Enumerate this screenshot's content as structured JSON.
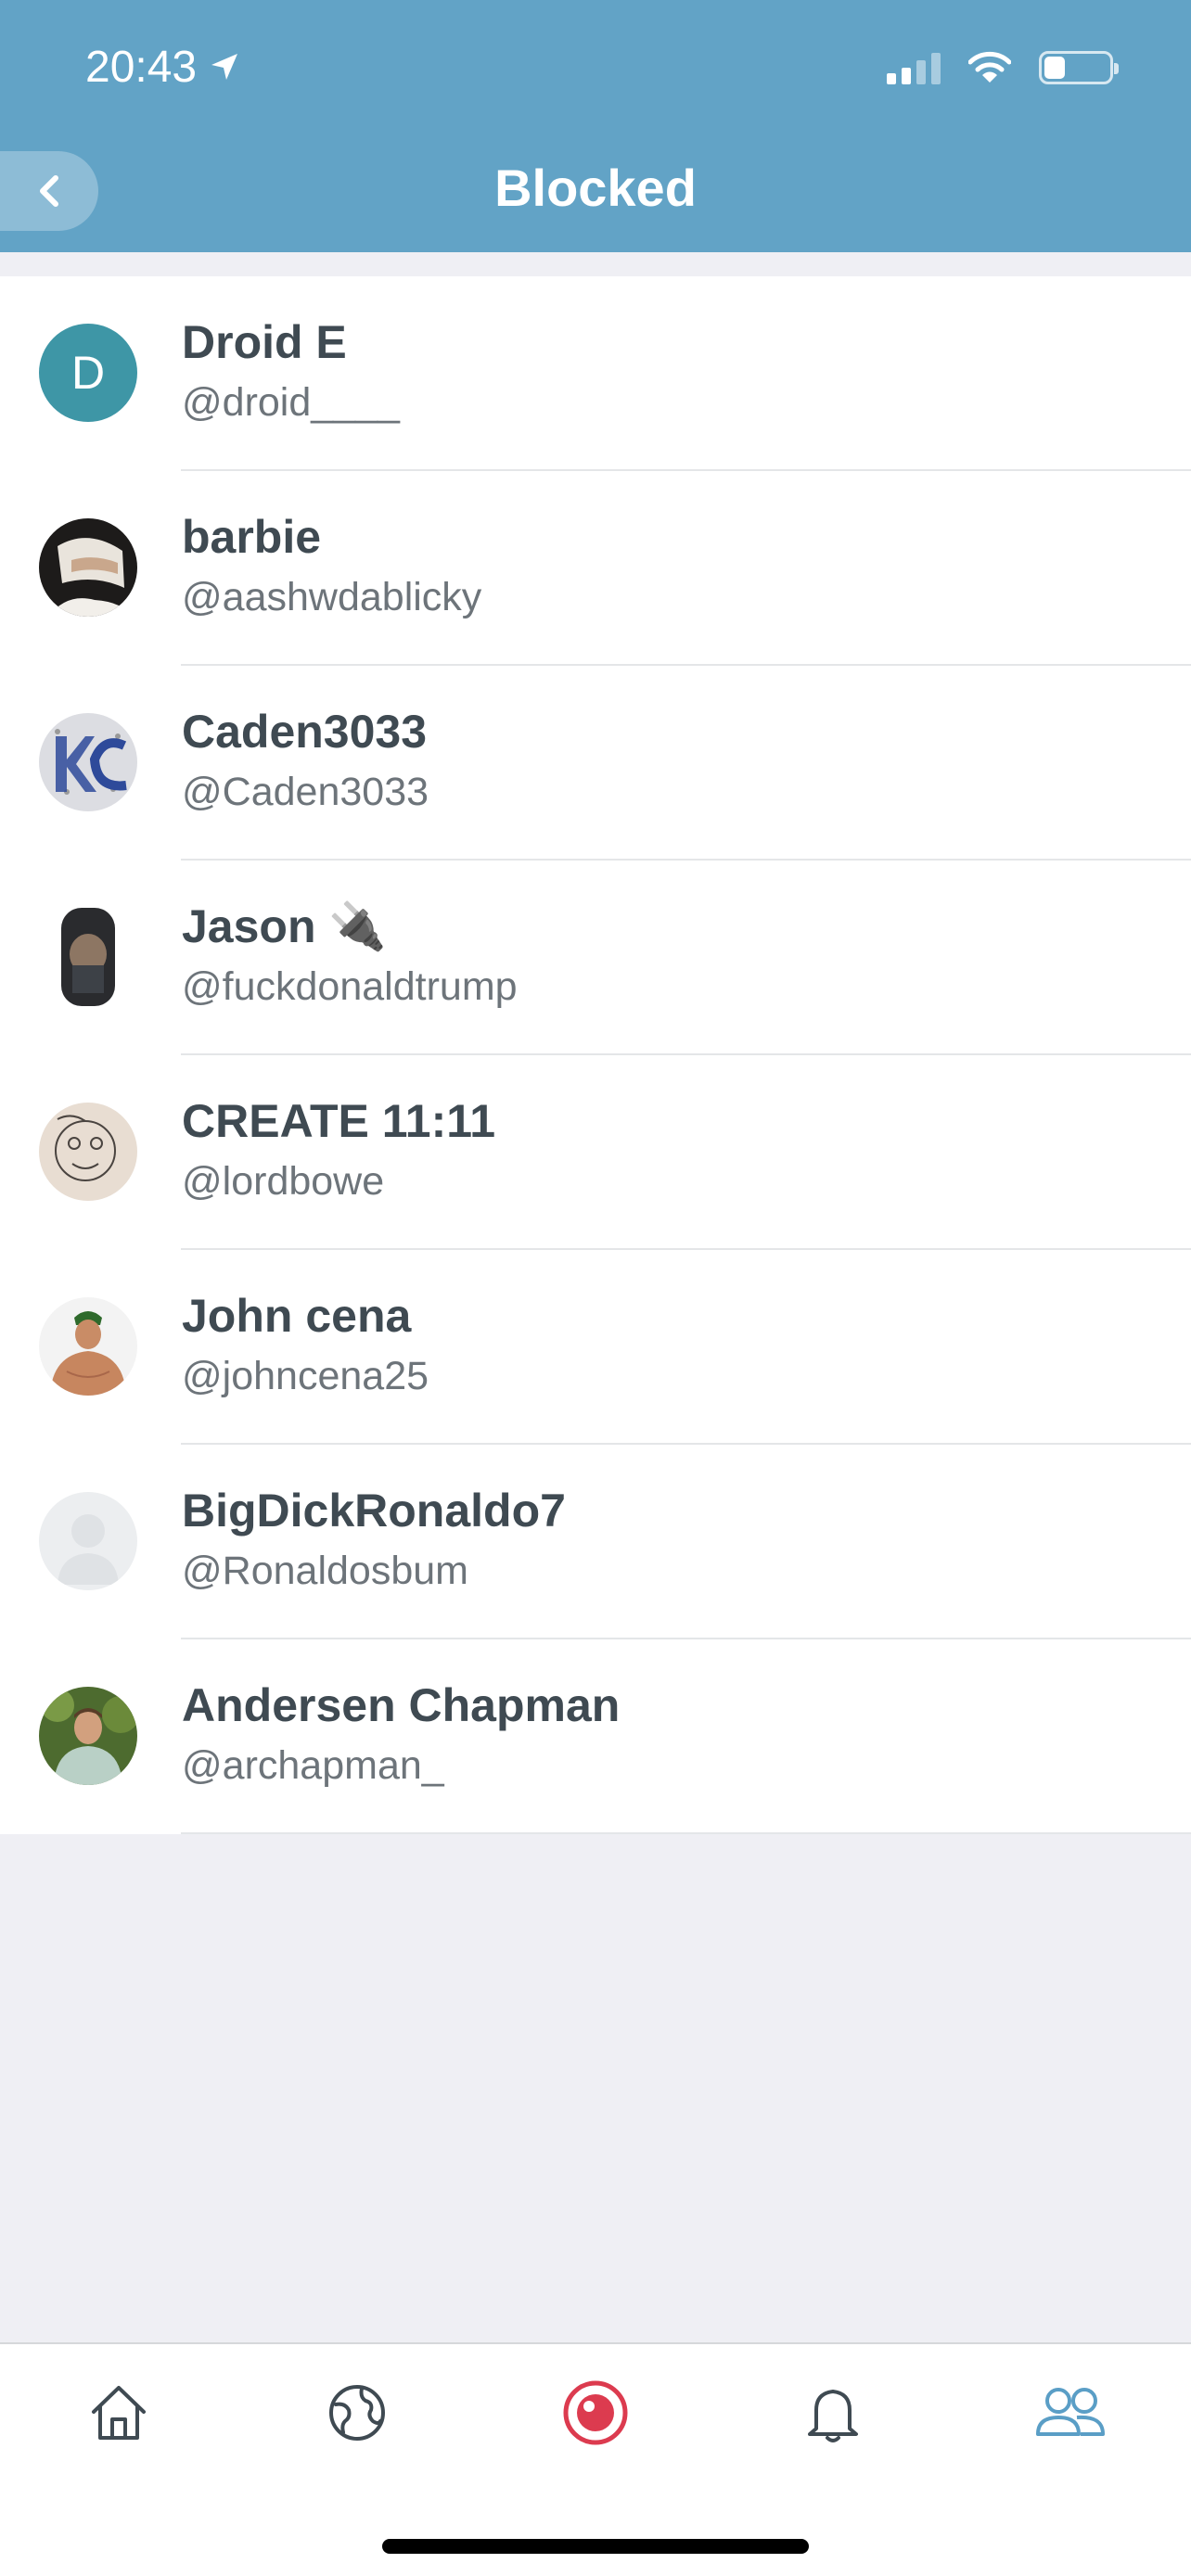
{
  "status_bar": {
    "time": "20:43"
  },
  "header": {
    "title": "Blocked"
  },
  "blocked_users": [
    {
      "name": "Droid E",
      "handle": "@droid____",
      "avatar_letter": "D"
    },
    {
      "name": "barbie",
      "handle": "@aashwdablicky"
    },
    {
      "name": "Caden3033",
      "handle": "@Caden3033"
    },
    {
      "name": "Jason 🔌",
      "handle": "@fuckdonaldtrump"
    },
    {
      "name": "CREATE 11:11",
      "handle": "@lordbowe"
    },
    {
      "name": "John cena",
      "handle": "@johncena25"
    },
    {
      "name": "BigDickRonaldo7",
      "handle": "@Ronaldosbum"
    },
    {
      "name": "Andersen Chapman",
      "handle": "@archapman_"
    }
  ],
  "tab_bar": {
    "tabs": [
      "home-icon",
      "globe-icon",
      "live-broadcast-icon",
      "notifications-bell-icon",
      "people-icon"
    ],
    "active_tab": "people-icon"
  },
  "colors": {
    "header": "#62a3c6",
    "live_accent": "#dc3b4f",
    "active_tab": "#5a9ec6"
  }
}
